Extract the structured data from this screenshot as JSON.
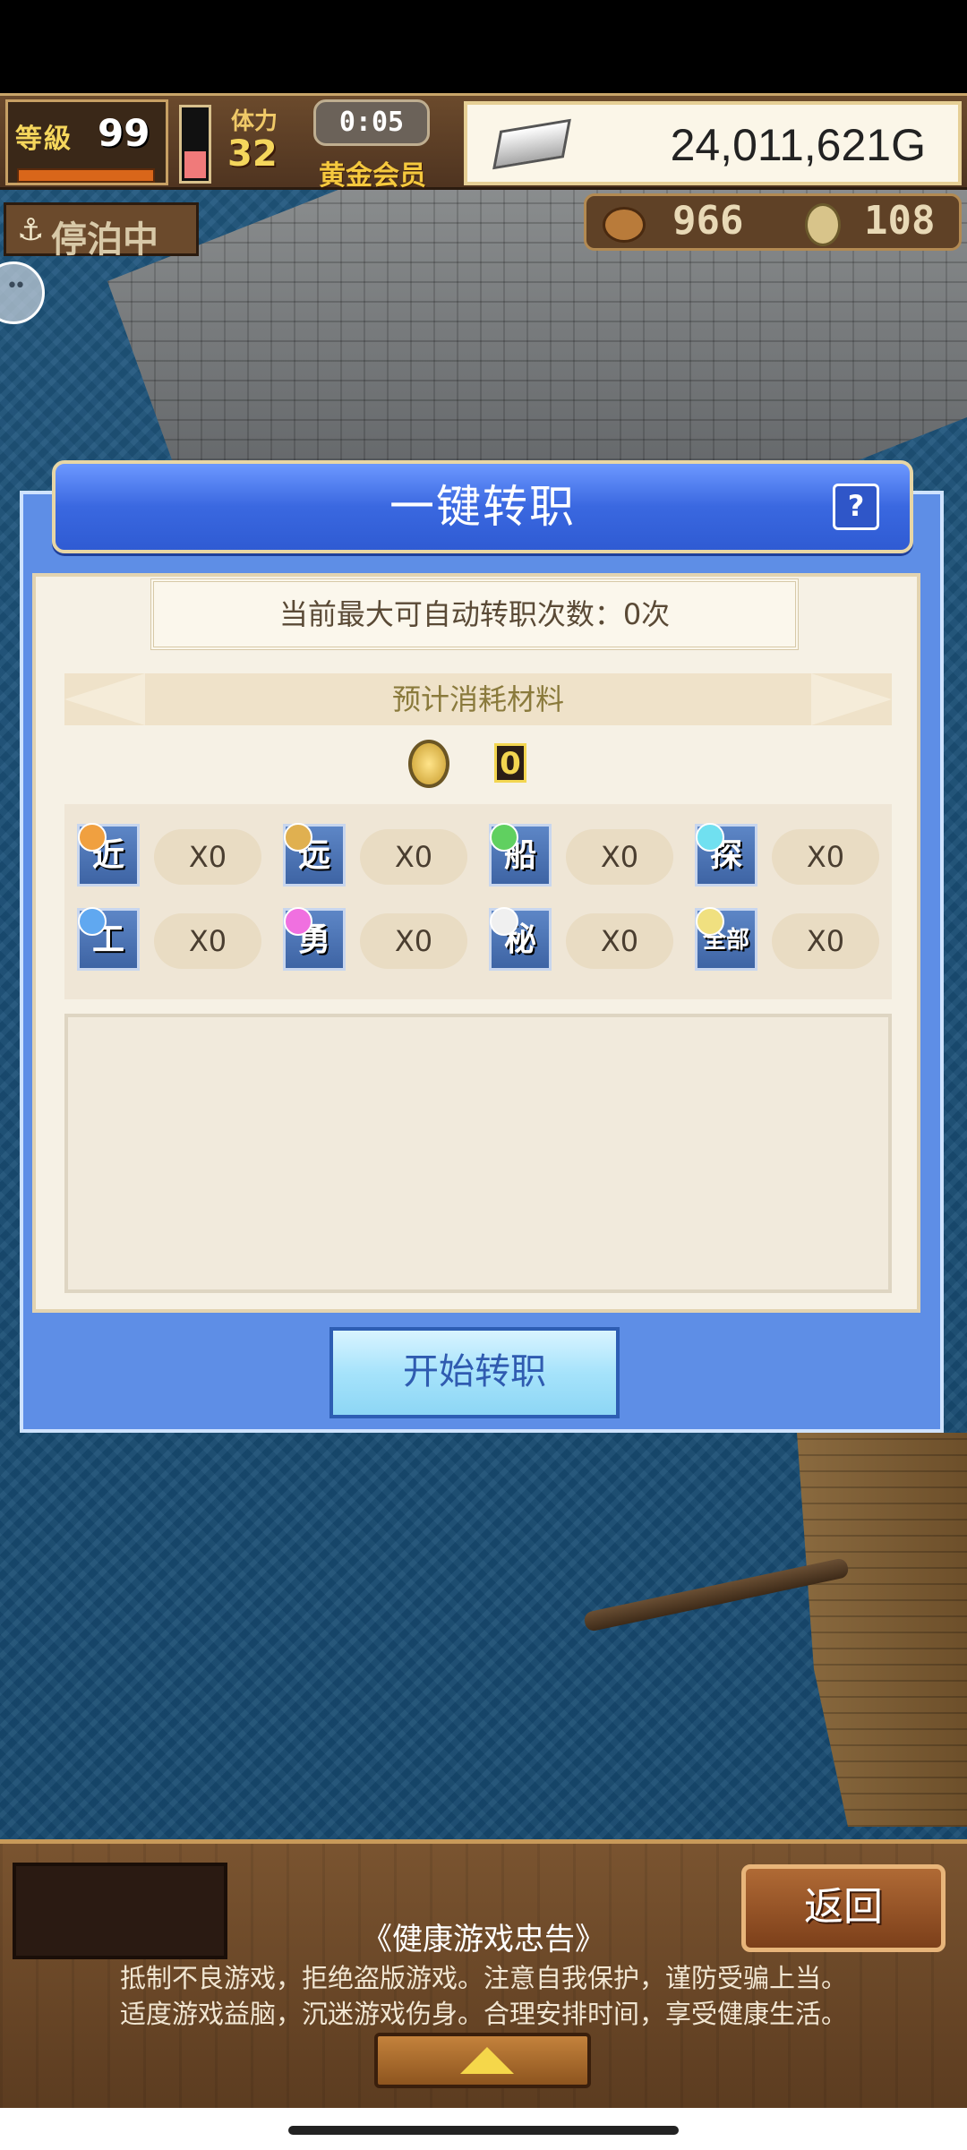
{
  "hud": {
    "level_label": "等級",
    "level": "99",
    "stamina_label": "体力",
    "stamina": "32",
    "timer": "0:05",
    "vip_label": "黄金会员",
    "gold": "24,011,621G",
    "moored_label": "停泊中",
    "resource1": "966",
    "resource2": "108"
  },
  "dialog": {
    "title": "一键转职",
    "help_label": "?",
    "max_text": "当前最大可自动转职次数：0次",
    "cost_header": "预计消耗材料",
    "cost_value": "0",
    "items": [
      {
        "icon_char": "近",
        "count": "X0",
        "orb_color": "#f0a040"
      },
      {
        "icon_char": "远",
        "count": "X0",
        "orb_color": "#e0b050"
      },
      {
        "icon_char": "船",
        "count": "X0",
        "orb_color": "#60d060"
      },
      {
        "icon_char": "探",
        "count": "X0",
        "orb_color": "#70e0f0"
      },
      {
        "icon_char": "工",
        "count": "X0",
        "orb_color": "#60a8f0"
      },
      {
        "icon_char": "勇",
        "count": "X0",
        "orb_color": "#f070e0"
      },
      {
        "icon_char": "秘",
        "count": "X0",
        "orb_color": "#f0f0f0"
      },
      {
        "icon_char": "全部",
        "count": "X0",
        "orb_color": "#f0e080"
      }
    ],
    "start_label": "开始转职"
  },
  "bottom": {
    "back_label": "返回",
    "advice_title": "《健康游戏忠告》",
    "advice_line1": "抵制不良游戏，拒绝盗版游戏。注意自我保护，谨防受骗上当。",
    "advice_line2": "适度游戏益脑，沉迷游戏伤身。合理安排时间，享受健康生活。"
  }
}
